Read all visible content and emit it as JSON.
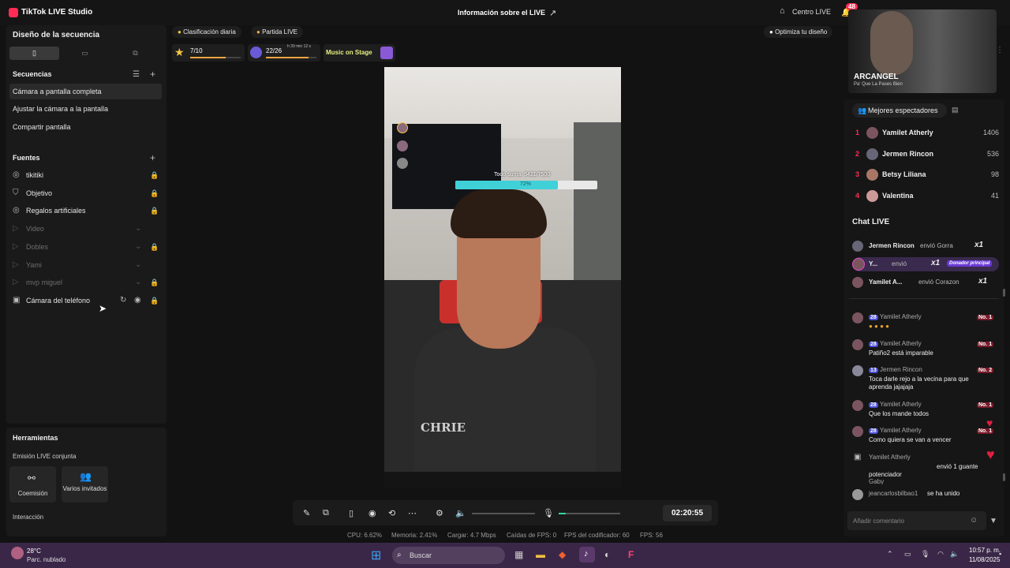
{
  "app": {
    "title": "TikTok LIVE Studio",
    "center_title": "Información sobre el LIVE",
    "centro": "Centro LIVE",
    "notif_count": "48"
  },
  "sequence_design": {
    "title": "Diseño de la secuencia"
  },
  "sequences": {
    "title": "Secuencias",
    "items": [
      "Cámara a pantalla completa",
      "Ajustar la cámara a la pantalla",
      "Compartir pantalla"
    ]
  },
  "sources": {
    "title": "Fuentes",
    "items": [
      {
        "label": "tikitiki",
        "muted": false
      },
      {
        "label": "Objetivo",
        "muted": false
      },
      {
        "label": "Regalos artificiales",
        "muted": false
      },
      {
        "label": "Video",
        "muted": true
      },
      {
        "label": "Dobles",
        "muted": true
      },
      {
        "label": "Yami",
        "muted": true
      },
      {
        "label": "mvp miguel",
        "muted": true
      },
      {
        "label": "Cámara del teléfono",
        "muted": false
      }
    ]
  },
  "tools": {
    "title": "Herramientas",
    "joint_label": "Emisión LIVE conjunta",
    "cohost": "Coemisión",
    "multi_guest": "Varios invitados",
    "interaction": "Interacción"
  },
  "topbar": {
    "daily_rank": "Clasificación diaria",
    "match": "Partida LIVE",
    "star_progress": "7/10",
    "star_fraction": 0.7,
    "orb_progress": "22/26",
    "orb_fraction": 0.846,
    "orb_time": "h 39 min 12 s",
    "music": "Music on Stage",
    "optimize": "Optimiza tu diseño"
  },
  "stage_overlay": {
    "goal_text": "Todo suma: 5421/7500",
    "goal_percent": "72%",
    "goal_fraction": 0.72,
    "shirt_text": "CHRIE"
  },
  "controls": {
    "timer": "02:20:55",
    "volume_fraction": 0.0,
    "mic_fraction": 0.12
  },
  "stats": {
    "cpu": "CPU: 6.62%",
    "memory": "Memoria: 2.41%",
    "upload": "Cargar: 4.7 Mbps",
    "fps_drops": "Caídas de FPS: 0",
    "encoder_fps": "FPS del codificador: 60",
    "fps": "FPS: 56"
  },
  "webcam": {
    "name": "ARCANGEL",
    "subtitle": "Pa' Que La Pases Bien"
  },
  "top_viewers": {
    "title": "Mejores espectadores",
    "rows": [
      {
        "rank": "1",
        "name": "Yamilet Atherly",
        "value": "1406"
      },
      {
        "rank": "2",
        "name": "Jermen Rincon",
        "value": "536"
      },
      {
        "rank": "3",
        "name": "Betsy Liliana",
        "value": "98"
      },
      {
        "rank": "4",
        "name": "Valentina",
        "value": "41"
      }
    ]
  },
  "chat": {
    "title": "Chat LIVE",
    "gifts": [
      {
        "name": "Jermen Rincon",
        "text": "envió Gorra",
        "count": "x1"
      },
      {
        "name": "Y...",
        "text": "envió",
        "count": "x1",
        "badge": "Donador principal"
      },
      {
        "name": "Yamilet A...",
        "text": "envió Corazon",
        "count": "x1"
      }
    ],
    "messages": [
      {
        "level": "28",
        "name": "Yamilet Atherly",
        "rank": "No. 1",
        "text": ""
      },
      {
        "level": "28",
        "name": "Yamilet Atherly",
        "rank": "No. 1",
        "text": "Patiño2 está imparable"
      },
      {
        "level": "13",
        "name": "Jermen Rincon",
        "rank": "No. 2",
        "text": "Toca darle rejo a la vecina para que aprenda jajajaja"
      },
      {
        "level": "28",
        "name": "Yamilet Atherly",
        "rank": "No. 1",
        "text": "Que los mande todos"
      },
      {
        "level": "28",
        "name": "Yamilet Atherly",
        "rank": "No. 1",
        "text": "Como quiera se van a vencer"
      }
    ],
    "gift_event": {
      "name": "Yamilet Atherly",
      "text": "envió 1 guante potenciador"
    },
    "partial": "Gaby",
    "joined": {
      "name": "jeancarlosbilbao1",
      "text": "se ha unido"
    },
    "input_placeholder": "Añadir comentario"
  },
  "taskbar": {
    "temp": "28°C",
    "weather": "Parc. nublado",
    "search": "Buscar",
    "time": "10:57 p. m.",
    "date": "11/08/2025"
  }
}
